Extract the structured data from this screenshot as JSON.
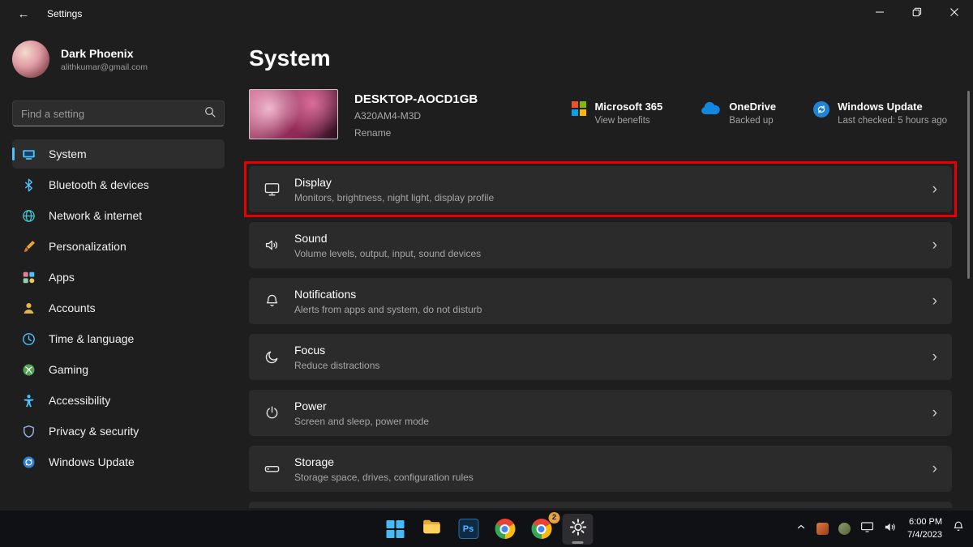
{
  "titlebar": {
    "title": "Settings"
  },
  "icons": {
    "back": "←",
    "chevron_right": "›"
  },
  "sidebar": {
    "user": {
      "name": "Dark Phoenix",
      "email": "alithkumar@gmail.com"
    },
    "search": {
      "placeholder": "Find a setting"
    },
    "items": [
      {
        "label": "System",
        "active": true
      },
      {
        "label": "Bluetooth & devices",
        "active": false
      },
      {
        "label": "Network & internet",
        "active": false
      },
      {
        "label": "Personalization",
        "active": false
      },
      {
        "label": "Apps",
        "active": false
      },
      {
        "label": "Accounts",
        "active": false
      },
      {
        "label": "Time & language",
        "active": false
      },
      {
        "label": "Gaming",
        "active": false
      },
      {
        "label": "Accessibility",
        "active": false
      },
      {
        "label": "Privacy & security",
        "active": false
      },
      {
        "label": "Windows Update",
        "active": false
      }
    ]
  },
  "main": {
    "title": "System",
    "device": {
      "name": "DESKTOP-AOCD1GB",
      "model": "A320AM4-M3D",
      "rename_label": "Rename"
    },
    "status_cards": [
      {
        "title": "Microsoft 365",
        "subtitle": "View benefits"
      },
      {
        "title": "OneDrive",
        "subtitle": "Backed up"
      },
      {
        "title": "Windows Update",
        "subtitle": "Last checked: 5 hours ago"
      }
    ],
    "rows": [
      {
        "title": "Display",
        "subtitle": "Monitors, brightness, night light, display profile",
        "highlighted": true
      },
      {
        "title": "Sound",
        "subtitle": "Volume levels, output, input, sound devices",
        "highlighted": false
      },
      {
        "title": "Notifications",
        "subtitle": "Alerts from apps and system, do not disturb",
        "highlighted": false
      },
      {
        "title": "Focus",
        "subtitle": "Reduce distractions",
        "highlighted": false
      },
      {
        "title": "Power",
        "subtitle": "Screen and sleep, power mode",
        "highlighted": false
      },
      {
        "title": "Storage",
        "subtitle": "Storage space, drives, configuration rules",
        "highlighted": false
      }
    ]
  },
  "taskbar": {
    "photoshop_label": "Ps",
    "chrome_badge": "2",
    "clock": {
      "time": "6:00 PM",
      "date": "7/4/2023"
    }
  },
  "colors": {
    "accent": "#4cc2ff",
    "annotation_red": "#e60000",
    "card_background": "#2b2b2b",
    "window_background": "#1e1e1e",
    "taskbar_background": "#101114"
  }
}
